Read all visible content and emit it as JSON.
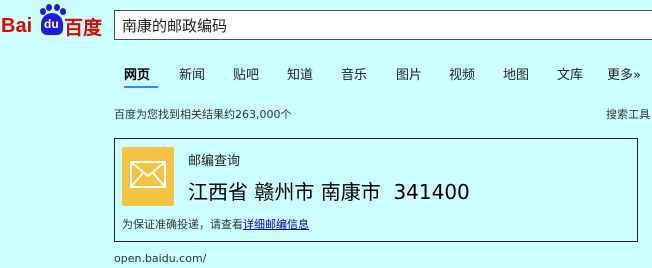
{
  "logo": {
    "bai": "Bai",
    "du": "du",
    "cn": "百度",
    "primary_color": "#e10601",
    "accent_color": "#2319dc"
  },
  "search": {
    "query": "南康的邮政编码"
  },
  "tabs": [
    {
      "label": "网页",
      "active": true
    },
    {
      "label": "新闻",
      "active": false
    },
    {
      "label": "贴吧",
      "active": false
    },
    {
      "label": "知道",
      "active": false
    },
    {
      "label": "音乐",
      "active": false
    },
    {
      "label": "图片",
      "active": false
    },
    {
      "label": "视频",
      "active": false
    },
    {
      "label": "地图",
      "active": false
    },
    {
      "label": "文库",
      "active": false
    },
    {
      "label": "更多»",
      "active": false
    }
  ],
  "results": {
    "count_text": "百度为您找到相关结果约263,000个",
    "tools_label": "搜索工具"
  },
  "card": {
    "icon": "envelope-icon",
    "title": "邮编查询",
    "location": "江西省 赣州市 南康市",
    "postcode": "341400",
    "note_prefix": "为保证准确投递，请查看",
    "note_link": "详细邮编信息",
    "icon_color": "#f5c342"
  },
  "source": {
    "url": "open.baidu.com/"
  }
}
